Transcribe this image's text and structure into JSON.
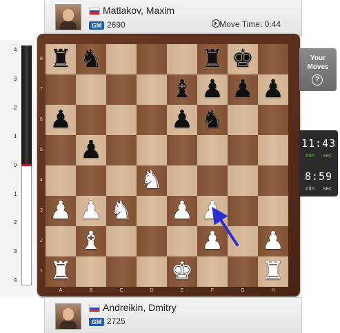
{
  "top_player": {
    "name": "Matlakov, Maxim",
    "title": "GM",
    "rating": "2690",
    "move_time_label": "Move Time: 0:44"
  },
  "bottom_player": {
    "name": "Andreikin, Dmitry",
    "title": "GM",
    "rating": "2725"
  },
  "side_panel": {
    "your_moves_line1": "Your",
    "your_moves_line2": "Moves",
    "help_glyph": "?"
  },
  "clocks": {
    "top_time": "11:43",
    "bottom_time": "8:59",
    "min_label": "min",
    "sec_label": "sec"
  },
  "eval_bar": {
    "ticks": [
      "4",
      "3",
      "2",
      "1",
      "0",
      "1",
      "2",
      "3",
      "4"
    ],
    "marker_color": "#c0182a"
  },
  "board": {
    "files": [
      "A",
      "B",
      "C",
      "D",
      "E",
      "F",
      "G",
      "H"
    ],
    "ranks": [
      "8",
      "7",
      "6",
      "5",
      "4",
      "3",
      "2",
      "1"
    ],
    "light_color": "#d8b898",
    "dark_color": "#8a5738",
    "pieces": [
      {
        "sq": "a8",
        "glyph": "♜",
        "color": "black",
        "name": "black-rook"
      },
      {
        "sq": "b8",
        "glyph": "♞",
        "color": "black",
        "name": "black-knight"
      },
      {
        "sq": "f8",
        "glyph": "♜",
        "color": "black",
        "name": "black-rook"
      },
      {
        "sq": "g8",
        "glyph": "♚",
        "color": "black",
        "name": "black-king"
      },
      {
        "sq": "e7",
        "glyph": "♝",
        "color": "black",
        "name": "black-bishop"
      },
      {
        "sq": "f7",
        "glyph": "♟",
        "color": "black",
        "name": "black-pawn"
      },
      {
        "sq": "g7",
        "glyph": "♟",
        "color": "black",
        "name": "black-pawn"
      },
      {
        "sq": "h7",
        "glyph": "♟",
        "color": "black",
        "name": "black-pawn"
      },
      {
        "sq": "a6",
        "glyph": "♟",
        "color": "black",
        "name": "black-pawn"
      },
      {
        "sq": "e6",
        "glyph": "♟",
        "color": "black",
        "name": "black-pawn"
      },
      {
        "sq": "f6",
        "glyph": "♞",
        "color": "black",
        "name": "black-knight"
      },
      {
        "sq": "b5",
        "glyph": "♟",
        "color": "black",
        "name": "black-pawn"
      },
      {
        "sq": "d4",
        "glyph": "♞",
        "color": "white",
        "name": "white-knight"
      },
      {
        "sq": "a3",
        "glyph": "♟",
        "color": "white",
        "name": "white-pawn"
      },
      {
        "sq": "b3",
        "glyph": "♟",
        "color": "white",
        "name": "white-pawn"
      },
      {
        "sq": "c3",
        "glyph": "♞",
        "color": "white",
        "name": "white-knight"
      },
      {
        "sq": "e3",
        "glyph": "♟",
        "color": "white",
        "name": "white-pawn"
      },
      {
        "sq": "f3",
        "glyph": "♟",
        "color": "white",
        "name": "white-pawn"
      },
      {
        "sq": "b2",
        "glyph": "♝",
        "color": "white",
        "name": "white-bishop"
      },
      {
        "sq": "f2",
        "glyph": "♟",
        "color": "white",
        "name": "white-pawn"
      },
      {
        "sq": "h2",
        "glyph": "♟",
        "color": "white",
        "name": "white-pawn"
      },
      {
        "sq": "a1",
        "glyph": "♜",
        "color": "white",
        "name": "white-rook"
      },
      {
        "sq": "e1",
        "glyph": "♚",
        "color": "white",
        "name": "white-king"
      },
      {
        "sq": "h1",
        "glyph": "♜",
        "color": "white",
        "name": "white-rook"
      }
    ],
    "arrow": {
      "from": "g2",
      "to": "f3",
      "color": "#2a2fd0"
    }
  }
}
